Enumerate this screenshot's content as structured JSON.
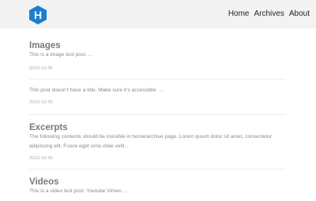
{
  "nav": {
    "items": [
      {
        "label": "Home"
      },
      {
        "label": "Archives"
      },
      {
        "label": "About"
      }
    ]
  },
  "logo": {
    "letter": "H",
    "color": "#1a7fd1"
  },
  "posts": [
    {
      "title": "Images",
      "excerpt": "This is a image test post. ...",
      "date": "2013-12-26"
    },
    {
      "title": "",
      "excerpt": "This post doesn’t have a title. Make sure it’s accessible. ...",
      "date": "2013-12-25"
    },
    {
      "title": "Excerpts",
      "excerpt": "The following contents should be invisible in home/archive page. Lorem ipsum dolor sit amet, consectetur adipiscing elit. Fusce eget urna vitae velit...",
      "date": "2013-12-25"
    },
    {
      "title": "Videos",
      "excerpt": "This is a video test post. Youtube Vimeo ...",
      "date": ""
    }
  ]
}
